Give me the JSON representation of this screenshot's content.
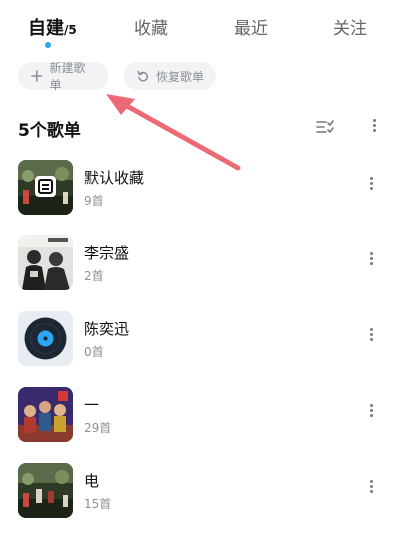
{
  "tabs": [
    {
      "label": "自建",
      "count": "/5"
    },
    {
      "label": "收藏"
    },
    {
      "label": "最近"
    },
    {
      "label": "关注"
    }
  ],
  "actions": {
    "new_playlist": "新建歌单",
    "restore_playlist": "恢复歌单"
  },
  "section": {
    "title": "5个歌单"
  },
  "playlists": [
    {
      "name": "默认收藏",
      "count": "9首"
    },
    {
      "name": "李宗盛",
      "count": "2首"
    },
    {
      "name": "陈奕迅",
      "count": "0首"
    },
    {
      "name": "一",
      "count": "29首"
    },
    {
      "name": "电",
      "count": "15首"
    }
  ],
  "colors": {
    "accent": "#2aa7f2",
    "annotation_arrow": "#ec6a75",
    "muted_text": "#8b8f96",
    "pill_bg": "#f1f3f5"
  }
}
